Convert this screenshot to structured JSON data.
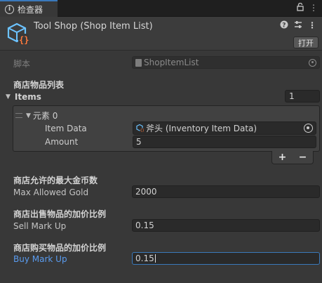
{
  "tab": {
    "label": "检查器"
  },
  "header": {
    "title": "Tool Shop (Shop Item List)",
    "open_button": "打开"
  },
  "script": {
    "label": "脚本",
    "value": "ShopItemList"
  },
  "items_section": {
    "heading": "商店物品列表",
    "label": "Items",
    "count": "1",
    "elements": [
      {
        "label": "元素 0",
        "item_data_label": "Item Data",
        "item_data_value": "斧头 (Inventory Item Data)",
        "amount_label": "Amount",
        "amount_value": "5"
      }
    ]
  },
  "max_gold": {
    "heading": "商店允许的最大金币数",
    "label": "Max Allowed Gold",
    "value": "2000"
  },
  "sell_markup": {
    "heading": "商店出售物品的加价比例",
    "label": "Sell Mark Up",
    "value": "0.15"
  },
  "buy_markup": {
    "heading": "商店购买物品的加价比例",
    "label": "Buy Mark Up",
    "value": "0.15"
  },
  "colors": {
    "focus": "#3a79bb",
    "active_label": "#5a9cf0",
    "background": "#383838"
  }
}
